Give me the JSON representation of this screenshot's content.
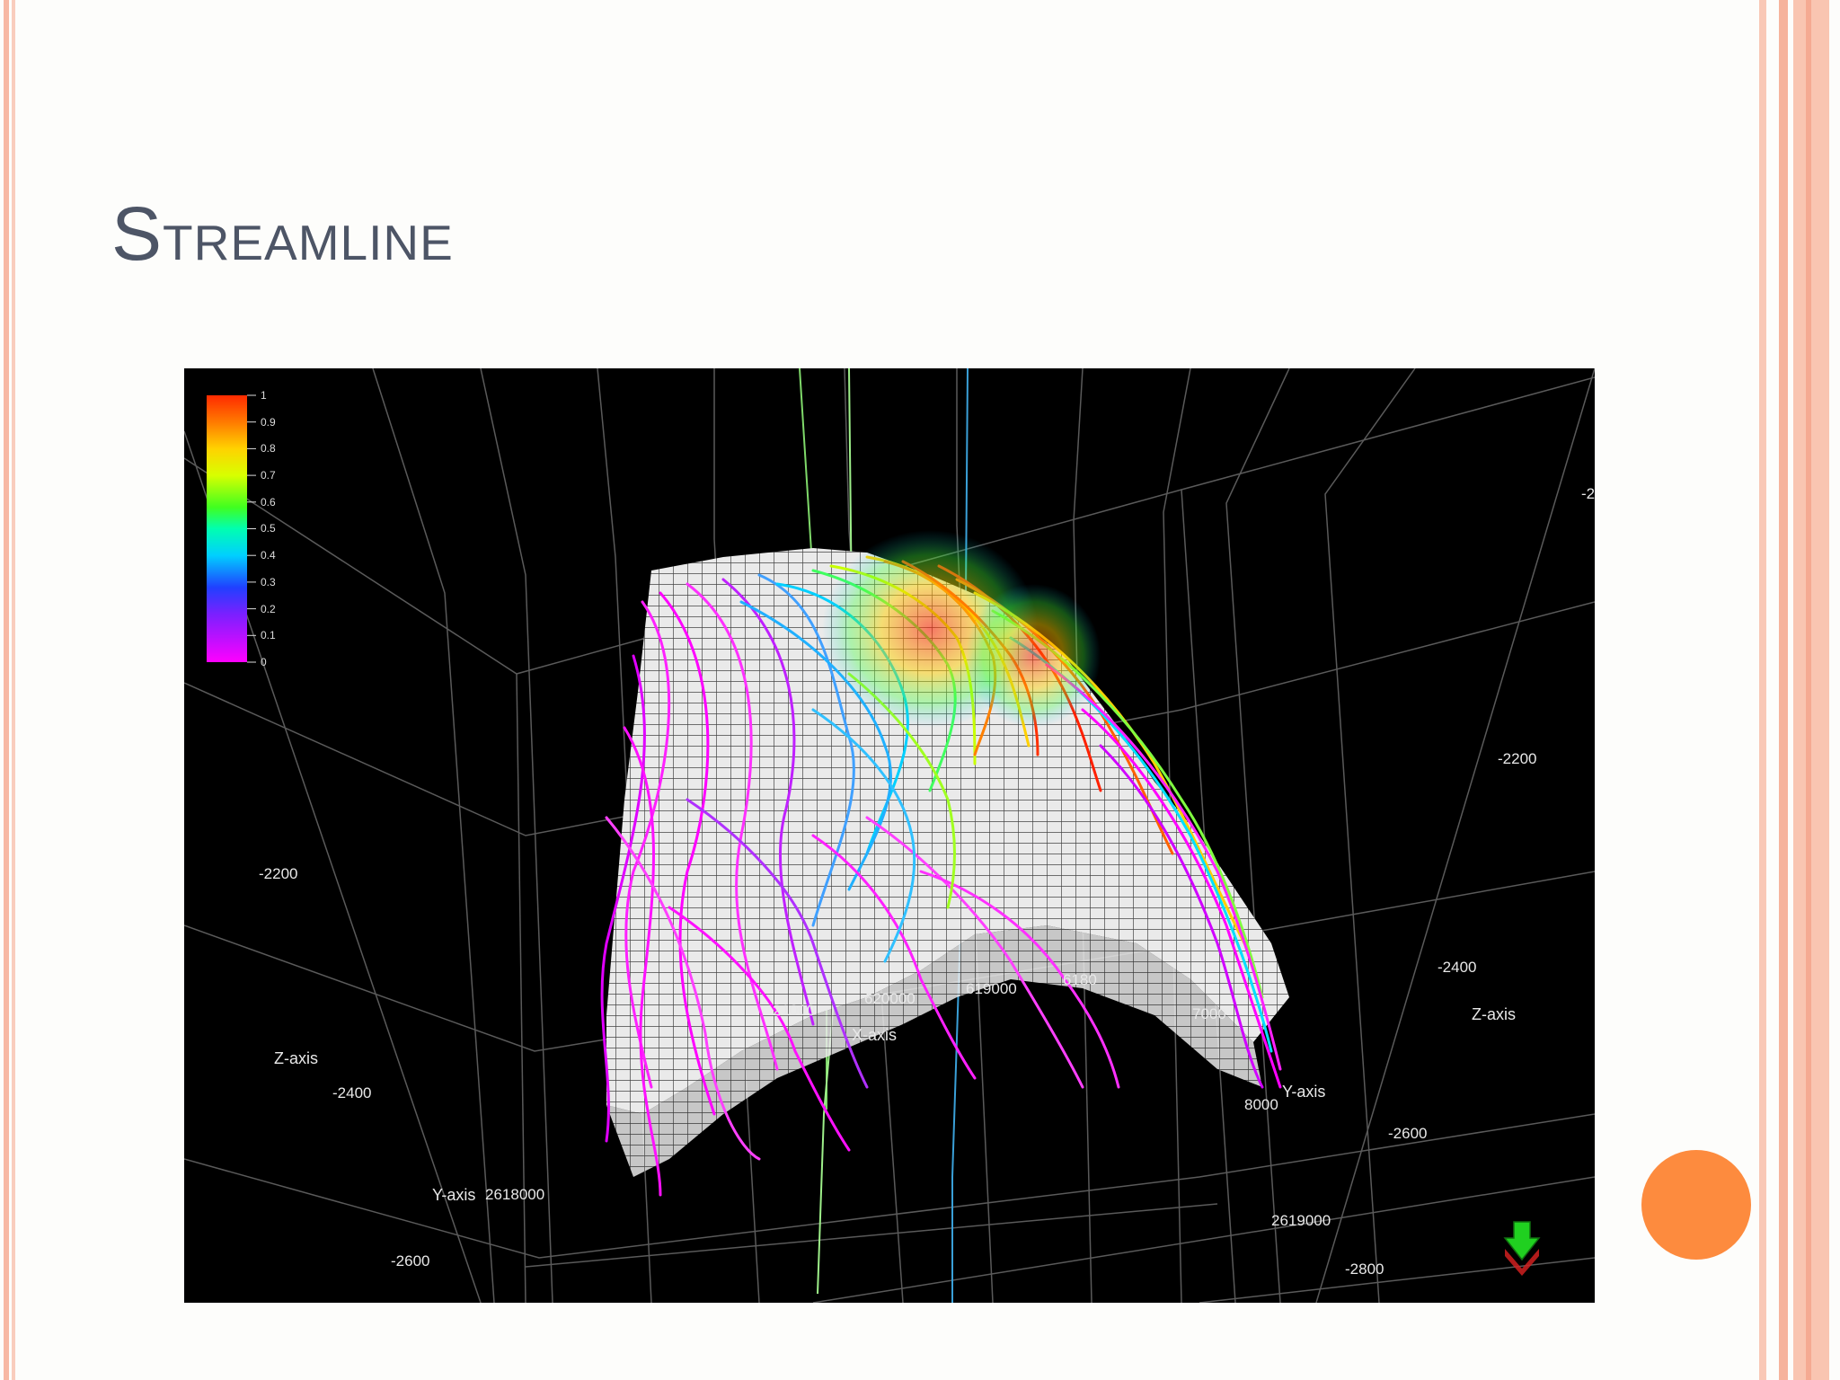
{
  "slide": {
    "title_first": "S",
    "title_rest": "treamline",
    "accent_dot_color": "#fd8b3e",
    "frame_color": "#f7b8a4"
  },
  "figure": {
    "background": "#000000",
    "colorbar": {
      "ticks": [
        "1",
        "0.9",
        "0.8",
        "0.7",
        "0.6",
        "0.5",
        "0.4",
        "0.3",
        "0.2",
        "0.1",
        "0"
      ],
      "colors": [
        "#ff2a00",
        "#ff7a00",
        "#ffcc00",
        "#d8ff00",
        "#5cff00",
        "#00ffa0",
        "#00d8ff",
        "#0080ff",
        "#3030ff",
        "#a020ff",
        "#ff00ff"
      ]
    },
    "axis_labels": {
      "x": "X-axis",
      "y_left": "Y-axis",
      "y_right": "Y-axis",
      "z_left": "Z-axis",
      "z_right": "Z-axis"
    },
    "tick_labels": {
      "z_left_upper": "-2200",
      "z_left_mid": "-2400",
      "z_left_lower": "-2600",
      "z_right_top": "-2",
      "z_right_1": "-2200",
      "z_right_2": "-2400",
      "z_right_3": "-2600",
      "z_right_4": "-2800",
      "x_1": "21000",
      "x_2": "620000",
      "x_3": "619000",
      "x_4": "6180",
      "x_5": "7000",
      "y_left_tick": "2618000",
      "y_right_tick": "8000",
      "y_right_bottom": "2619000"
    },
    "orientation_icon": "compass-arrow-icon"
  }
}
